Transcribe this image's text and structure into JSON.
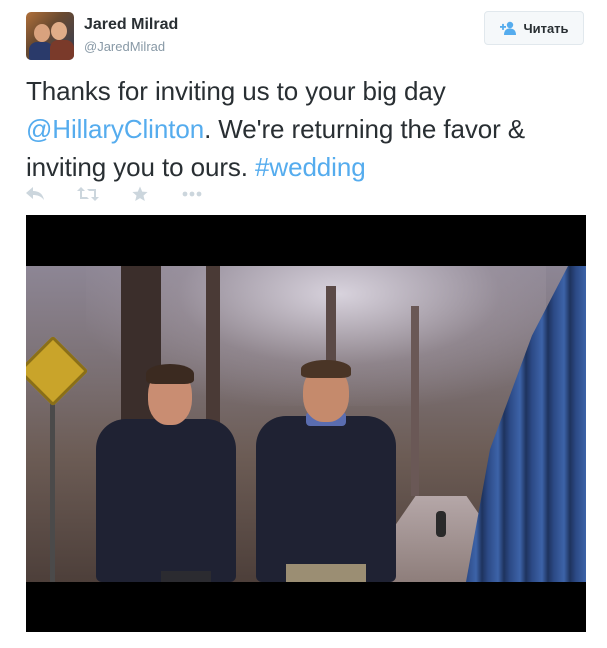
{
  "user": {
    "name": "Jared Milrad",
    "handle": "@JaredMilrad"
  },
  "follow_button": {
    "label": "Читать"
  },
  "tweet": {
    "text_part1": "Thanks for inviting us to your big day ",
    "mention": "@HillaryClinton",
    "text_part2": ". We're returning the favor & inviting you to ours. ",
    "hashtag": "#wedding"
  },
  "actions": [
    "reply-icon",
    "retweet-icon",
    "favorite-icon",
    "more-icon"
  ],
  "colors": {
    "link": "#55acee",
    "text": "#292f33",
    "muted": "#8899a6",
    "action_icon": "#ccd6dd"
  }
}
